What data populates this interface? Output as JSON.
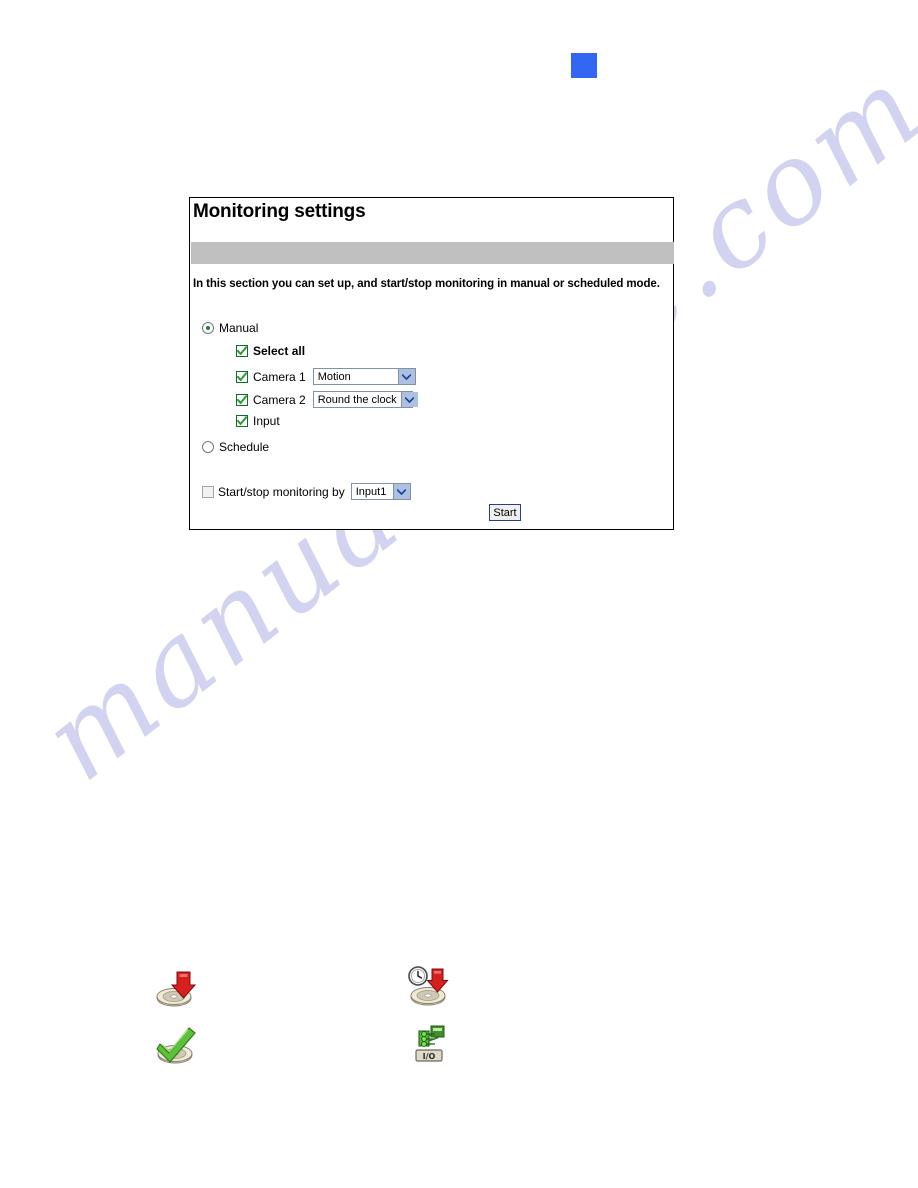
{
  "document": {
    "watermark_text": "manualshive.com",
    "watermark_color": "#c9c9ef"
  },
  "marker": {
    "name": "blue-square-marker",
    "color": "#3366f2"
  },
  "panel": {
    "title": "Monitoring settings",
    "description": "In this section you can set up, and start/stop monitoring in manual or scheduled mode.",
    "divider_color": "#c0c0c0",
    "border_color": "#000000",
    "mode": {
      "manual": {
        "label": "Manual",
        "selected": true
      },
      "schedule": {
        "label": "Schedule",
        "selected": false
      }
    },
    "checkboxes": [
      {
        "label": "Select all",
        "checked": true,
        "bold": true
      },
      {
        "label": "Camera 1",
        "checked": true,
        "bold": false
      },
      {
        "label": "Camera 2",
        "checked": true,
        "bold": false
      },
      {
        "label": "Input",
        "checked": true,
        "bold": false
      }
    ],
    "selects": {
      "camera1": {
        "value": "Motion",
        "options": [
          "Motion",
          "Round the clock"
        ]
      },
      "camera2": {
        "value": "Round the clock",
        "options": [
          "Motion",
          "Round the clock"
        ]
      },
      "trigger": {
        "value": "Input1",
        "options": [
          "Input1"
        ]
      }
    },
    "startstop": {
      "label": "Start/stop monitoring by",
      "checked": false
    },
    "start_button": {
      "label": "Start"
    },
    "colors": {
      "checkbox_check": "#2d9b2d",
      "checkbox_border": "#0f6b2f",
      "select_arrow_bg": "#adc0e0",
      "radio_dot": "#2d7a2d",
      "button_border": "#27427a"
    }
  },
  "legend_icons": [
    {
      "name": "recording-start-icon",
      "position": "top-left"
    },
    {
      "name": "scheduled-recording-icon",
      "position": "top-right"
    },
    {
      "name": "recording-ok-icon",
      "position": "bottom-left"
    },
    {
      "name": "io-device-status-icon",
      "position": "bottom-right"
    }
  ]
}
